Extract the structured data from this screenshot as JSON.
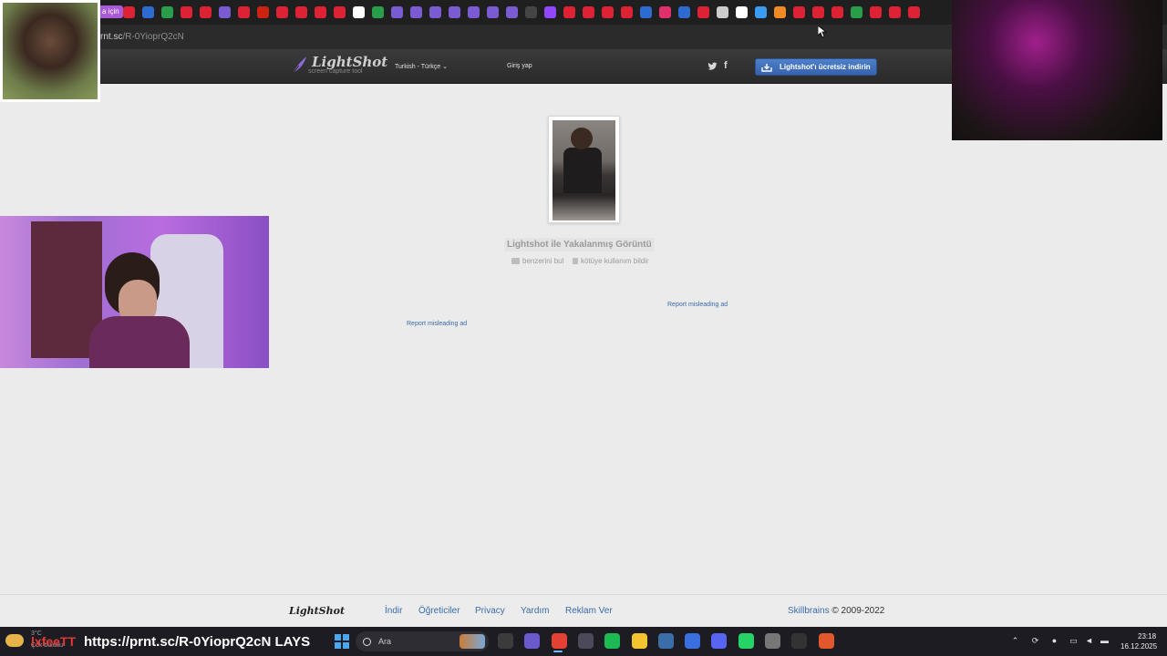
{
  "browser": {
    "bookmark_pill_label": "a için",
    "bookmark_icons": [
      "#d23",
      "#d23",
      "#2d6bd1",
      "#2a9d4a",
      "#d23",
      "#d23",
      "#7a5bd1",
      "#d23",
      "#c21",
      "#d23",
      "#d23",
      "#d23",
      "#d23",
      "#fff",
      "#2a9d4a",
      "#7a5bd1",
      "#7a5bd1",
      "#7a5bd1",
      "#7a5bd1",
      "#7a5bd1",
      "#7a5bd1",
      "#7a5bd1",
      "#444",
      "#9147ff",
      "#d23",
      "#d23",
      "#d23",
      "#d23",
      "#2d6bd1",
      "#e1306c",
      "#2d6bd1",
      "#d23",
      "#ccc",
      "#fff",
      "#3a9bf0",
      "#f08a24",
      "#d23",
      "#d23",
      "#d23",
      "#2a9d4a",
      "#d23",
      "#d23",
      "#d23"
    ],
    "url_host": "rnt.sc",
    "url_path": "/R-0YioprQ2cN"
  },
  "header": {
    "brand": "LightShot",
    "tagline": "screen capture tool",
    "language": "Turkish - Türkçe",
    "login": "Giriş yap",
    "facebook_glyph": "f",
    "download_label": "Lightshot'ı ücretsiz indirin"
  },
  "main": {
    "caption": "Lightshot ile Yakalanmış Görüntü",
    "find_similar": "benzerini bul",
    "report_abuse": "kötüye kullanım bildir",
    "report_ad": "Report misleading ad"
  },
  "footer": {
    "brand": "LightShot",
    "links": [
      "İndir",
      "Öğreticiler",
      "Privacy",
      "Yardım",
      "Reklam Ver"
    ],
    "company": "Skillbrains",
    "copyright": "© 2009-2022"
  },
  "overlay": {
    "url_text": "https://prnt.sc/R-0YioprQ2cN LAYS",
    "streamer_name": "lxfeeTT",
    "weather_temp": "3°C",
    "weather_desc": "Çok bulutlu"
  },
  "taskbar": {
    "search_placeholder": "Ara",
    "time": "23:18",
    "date": "16.12.2025",
    "apps": [
      "#3b3b3b",
      "#6a5acd",
      "#e34133",
      "#4a4a5a",
      "#1db954",
      "#f4c430",
      "#3b6ea8",
      "#3a6fe0",
      "#5865f2",
      "#25d366",
      "#777",
      "#333",
      "#e2572b"
    ],
    "colors": {
      "accent": "#4aa7f0"
    }
  }
}
